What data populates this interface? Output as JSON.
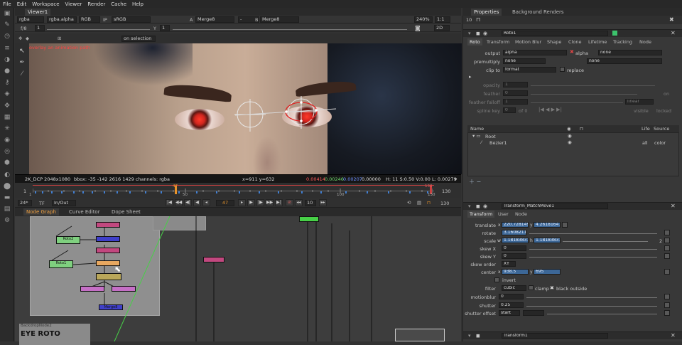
{
  "menubar": {
    "items": [
      "File",
      "Edit",
      "Workspace",
      "Viewer",
      "Render",
      "Cache",
      "Help"
    ]
  },
  "viewer": {
    "tab": "Viewer1",
    "bar1": {
      "channels": "rgba",
      "layer": "rgba.alpha",
      "display": "RGB",
      "ip": "IP",
      "colorspace": "sRGB",
      "input_a_label": "A",
      "input_a": "Merge8",
      "compare": "-",
      "input_b_label": "B",
      "input_b": "Merge8",
      "zoom": "240%",
      "ratio": "1:1",
      "mode": "2D"
    },
    "bar2": {
      "fstop": "f/8",
      "exposure": "1",
      "y_label": "Y",
      "gamma": "1"
    },
    "bar3": {
      "overlay": "on selection",
      "warning": "overlay an animation path"
    },
    "info": {
      "format": "2K_DCP 2048x1080",
      "bbox": "bbox: -35 -142 2616 1429 channels: rgba",
      "coords": "x=911 y=632",
      "r": "0.00414",
      "g": "0.00246",
      "b": "0.00207",
      "a": "0.00000",
      "hsvl": "H: 11 S:0.50 V:0.00  L: 0.00279"
    },
    "timeline": {
      "start": "1",
      "end": "130",
      "ticks": [
        "1",
        "50",
        "100",
        "130"
      ],
      "current": "47",
      "marker_end": "130"
    },
    "playbar": {
      "fps": "24*",
      "tf": "TF",
      "inout": "In/Out",
      "frame": "47",
      "step": "10",
      "end": "130"
    }
  },
  "nodegraph": {
    "tabs": [
      "Node Graph",
      "Curve Editor",
      "Dope Sheet"
    ],
    "backdrop_title": "EYE ROTO",
    "backdrop_label": "BackdropNode2",
    "nodes": [
      "Roto2",
      "Roto1",
      "Transform_MatchMove1",
      "Merge8"
    ]
  },
  "properties": {
    "tabs": [
      "Properties",
      "Background Renders"
    ],
    "max_panels": "10",
    "roto": {
      "name": "Roto1",
      "tabs": [
        "Roto",
        "Transform",
        "Motion Blur",
        "Shape",
        "Clone",
        "Lifetime",
        "Tracking",
        "Node"
      ],
      "output": "alpha",
      "output_check": "alpha",
      "output_none": "none",
      "premultiply": "none",
      "premultiply_none": "none",
      "clip_to": "format",
      "replace": "replace",
      "opacity": "1",
      "feather": "0",
      "feather_falloff": "1",
      "falloff_type": "linear",
      "on": "on",
      "spline_key": "0",
      "spline_key_of": "of 0",
      "visible": "visible",
      "locked": "locked",
      "labels": {
        "output": "output",
        "premultiply": "premultiply",
        "clip_to": "clip to",
        "opacity": "opacity",
        "feather": "feather",
        "feather_falloff": "feather falloff",
        "spline_key": "spline key"
      },
      "tree_headers": [
        "Name",
        "Life",
        "Source"
      ],
      "tree": [
        {
          "name": "Root",
          "life": "",
          "source": ""
        },
        {
          "name": "Bezier1",
          "life": "all",
          "source": "color"
        }
      ]
    },
    "transform": {
      "name": "Transform_MatchMove1",
      "tabs": [
        "Transform",
        "User",
        "Node"
      ],
      "translate_x": "220.728149",
      "translate_y": "4.26181641",
      "rotate": "3.16082118",
      "scale_w": "1.18183831",
      "scale_h": "1.18183831",
      "scale_n": "2",
      "skew_x": "0",
      "skew_y": "0",
      "skew_order": "XY",
      "center_x": "938.5",
      "center_y": "695",
      "invert": "invert",
      "filter": "cubic",
      "clamp": "clamp",
      "black_outside": "black outside",
      "motionblur": "0",
      "shutter": "0.25",
      "shutter_offset": "start",
      "labels": {
        "translate": "translate",
        "rotate": "rotate",
        "scale": "scale",
        "skew_x": "skew X",
        "skew_y": "skew Y",
        "skew_order": "skew order",
        "center": "center",
        "filter": "filter",
        "motionblur": "motionblur",
        "shutter": "shutter",
        "shutter_offset": "shutter offset"
      }
    },
    "next_panel": "Transform1"
  }
}
